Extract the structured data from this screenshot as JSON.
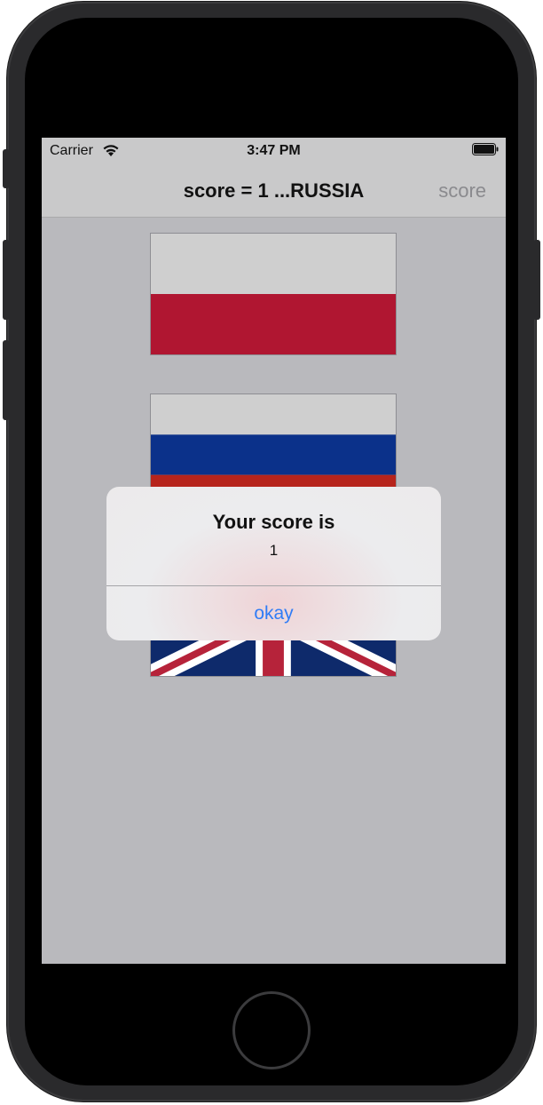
{
  "status_bar": {
    "carrier": "Carrier",
    "time": "3:47 PM",
    "wifi_icon": "wifi-icon",
    "battery_icon": "battery-full-icon"
  },
  "navbar": {
    "title": "score = 1 ...RUSSIA",
    "right_button": "score"
  },
  "flags": [
    {
      "name": "flag-poland",
      "country": "Poland"
    },
    {
      "name": "flag-russia",
      "country": "Russia"
    },
    {
      "name": "flag-uk",
      "country": "United Kingdom"
    }
  ],
  "alert": {
    "title": "Your score is",
    "message": "1",
    "action": "okay"
  },
  "colors": {
    "accent": "#2f7cf6",
    "background": "#b9b9bd",
    "navbar": "#c9c9ca"
  }
}
